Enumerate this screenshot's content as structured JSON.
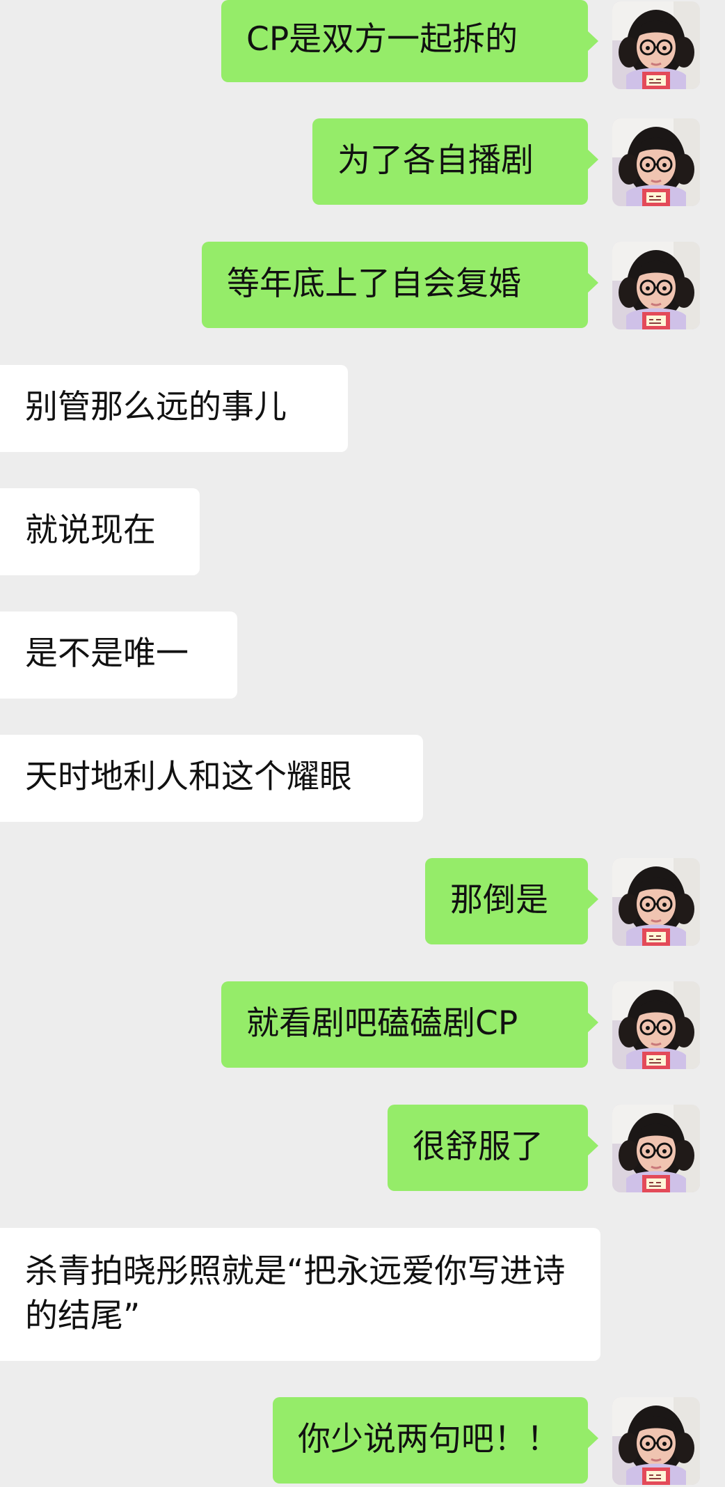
{
  "chat": {
    "messages": [
      {
        "side": "sent",
        "text": "CP是双方一起拆的"
      },
      {
        "side": "sent",
        "text": "为了各自播剧"
      },
      {
        "side": "sent",
        "text": "等年底上了自会复婚"
      },
      {
        "side": "received",
        "text": "别管那么远的事儿"
      },
      {
        "side": "received",
        "text": "就说现在"
      },
      {
        "side": "received",
        "text": "是不是唯一"
      },
      {
        "side": "received",
        "text": "天时地利人和这个耀眼"
      },
      {
        "side": "sent",
        "text": "那倒是"
      },
      {
        "side": "sent",
        "text": "就看剧吧磕磕剧CP"
      },
      {
        "side": "sent",
        "text": "很舒服了"
      },
      {
        "side": "received",
        "text": "杀青拍晓彤照就是“把永远爱你写进诗的结尾”"
      },
      {
        "side": "sent",
        "text": "你少说两句吧！！"
      }
    ],
    "avatar_icon": "child-avatar-icon",
    "colors": {
      "background": "#ededed",
      "sent_bubble": "#95ec69",
      "received_bubble": "#ffffff",
      "text": "#111111"
    }
  }
}
